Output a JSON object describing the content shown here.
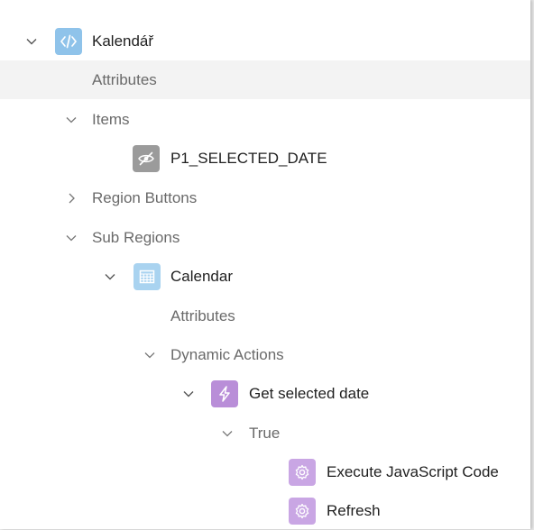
{
  "tree": {
    "region_kalendar": {
      "label": "Kalendář",
      "icon": "code-region-icon"
    },
    "attributes_1": {
      "label": "Attributes"
    },
    "items": {
      "label": "Items"
    },
    "item_p1": {
      "label": "P1_SELECTED_DATE",
      "icon": "hidden-item-icon"
    },
    "region_buttons": {
      "label": "Region Buttons"
    },
    "sub_regions": {
      "label": "Sub Regions"
    },
    "calendar": {
      "label": "Calendar",
      "icon": "calendar-region-icon"
    },
    "attributes_2": {
      "label": "Attributes"
    },
    "dynamic_actions": {
      "label": "Dynamic Actions"
    },
    "get_selected_date": {
      "label": "Get selected date",
      "icon": "lightning-icon"
    },
    "true_branch": {
      "label": "True"
    },
    "execute_js": {
      "label": "Execute JavaScript Code",
      "icon": "gear-action-icon"
    },
    "refresh": {
      "label": "Refresh",
      "icon": "gear-action-icon"
    }
  },
  "colors": {
    "code_icon_bg": "#8fc3ea",
    "hidden_icon_bg": "#9b9b9b",
    "calendar_icon_bg": "#a9d3f0",
    "dynamic_action_bg": "#b98ed8",
    "action_bg": "#c9a6e4",
    "selected_row": "#f3f3f3"
  }
}
